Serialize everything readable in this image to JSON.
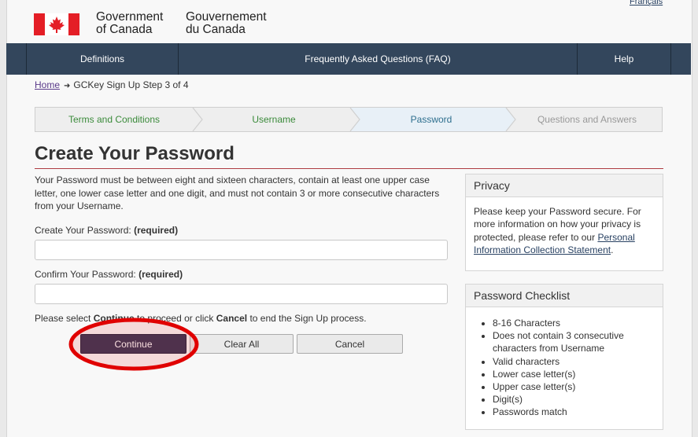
{
  "header": {
    "language_link": "Français",
    "wordmark_en": [
      "Government",
      "of Canada"
    ],
    "wordmark_fr": [
      "Gouvernement",
      "du Canada"
    ]
  },
  "nav": {
    "items": [
      {
        "label": "Definitions"
      },
      {
        "label": "Frequently Asked Questions (FAQ)"
      },
      {
        "label": "Help"
      }
    ]
  },
  "breadcrumb": {
    "home": "Home",
    "current": "GCKey Sign Up Step 3 of 4"
  },
  "steps": [
    {
      "label": "Terms and Conditions",
      "state": "completed"
    },
    {
      "label": "Username",
      "state": "completed"
    },
    {
      "label": "Password",
      "state": "active"
    },
    {
      "label": "Questions and Answers",
      "state": "upcoming"
    }
  ],
  "main": {
    "title": "Create Your Password",
    "intro": "Your Password must be between eight and sixteen characters, contain at least one upper case letter, one lower case letter and one digit, and must not contain 3 or more consecutive characters from your Username.",
    "password_label": "Create Your Password:",
    "confirm_label": "Confirm Your Password:",
    "required_text": "(required)",
    "password_value": "",
    "confirm_value": "",
    "instructions": {
      "part1": "Please select ",
      "continue_word": "Continue",
      "part2": " to proceed or click ",
      "cancel_word": "Cancel",
      "part3": " to end the Sign Up process."
    },
    "buttons": {
      "continue": "Continue",
      "clear_all": "Clear All",
      "cancel": "Cancel"
    }
  },
  "privacy_panel": {
    "heading": "Privacy",
    "text": "Please keep your Password secure. For more information on how your privacy is protected, please refer to our ",
    "link": "Personal Information Collection Statement",
    "end": "."
  },
  "checklist_panel": {
    "heading": "Password Checklist",
    "items": [
      "8-16 Characters",
      "Does not contain 3 consecutive characters from Username",
      "Valid characters",
      "Lower case letter(s)",
      "Upper case letter(s)",
      "Digit(s)",
      "Passwords match"
    ]
  },
  "colors": {
    "nav_bg": "#33465c",
    "primary_button": "#3c3857",
    "completed_step": "#3a8a3a",
    "active_step": "#2e6f8e",
    "heading_rule": "#af3c43",
    "flag_red": "#e41e26",
    "annotation_red": "#e00000"
  }
}
